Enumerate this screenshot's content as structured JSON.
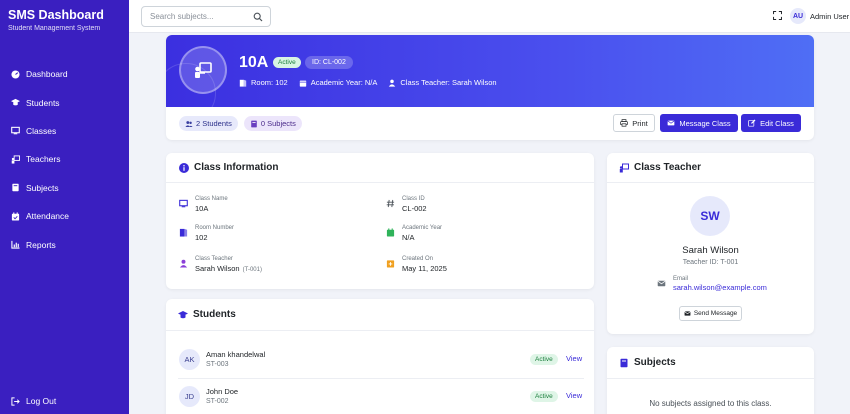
{
  "sidebar": {
    "title": "SMS Dashboard",
    "subtitle": "Student Management System",
    "items": [
      {
        "label": "Dashboard",
        "icon": "dashboard-icon"
      },
      {
        "label": "Students",
        "icon": "graduation-cap-icon"
      },
      {
        "label": "Classes",
        "icon": "chalkboard-icon"
      },
      {
        "label": "Teachers",
        "icon": "chalkboard-teacher-icon"
      },
      {
        "label": "Subjects",
        "icon": "book-icon"
      },
      {
        "label": "Attendance",
        "icon": "calendar-check-icon"
      },
      {
        "label": "Reports",
        "icon": "chart-icon"
      }
    ],
    "logout_label": "Log Out"
  },
  "topbar": {
    "search_placeholder": "Search subjects...",
    "avatar_initials": "AU",
    "user_name": "Admin User"
  },
  "class": {
    "name": "10A",
    "status": "Active",
    "id_badge": "ID: CL-002",
    "room": "Room: 102",
    "academic_year": "Academic Year: N/A",
    "class_teacher": "Class Teacher: Sarah Wilson",
    "students_chip": "2 Students",
    "subjects_chip": "0 Subjects"
  },
  "actions": {
    "print": "Print",
    "message": "Message Class",
    "edit": "Edit Class"
  },
  "info": {
    "title": "Class Information",
    "class_name_label": "Class Name",
    "class_name": "10A",
    "class_id_label": "Class ID",
    "class_id": "CL-002",
    "room_label": "Room Number",
    "room": "102",
    "year_label": "Academic Year",
    "year": "N/A",
    "teacher_label": "Class Teacher",
    "teacher": "Sarah Wilson",
    "teacher_code": "(T-001)",
    "created_label": "Created On",
    "created": "May 11, 2025"
  },
  "students": {
    "title": "Students",
    "rows": [
      {
        "initials": "AK",
        "name": "Aman khandelwal",
        "id": "ST-003",
        "status": "Active",
        "action": "View"
      },
      {
        "initials": "JD",
        "name": "John Doe",
        "id": "ST-002",
        "status": "Active",
        "action": "View"
      }
    ]
  },
  "teacher": {
    "title": "Class Teacher",
    "initials": "SW",
    "name": "Sarah Wilson",
    "teacher_id": "Teacher ID: T-001",
    "email_label": "Email",
    "email": "sarah.wilson@example.com",
    "send_label": "Send Message"
  },
  "subjects": {
    "title": "Subjects",
    "empty": "No subjects assigned to this class."
  },
  "colors": {
    "sidebar": "#3a1fc0",
    "accent": "#3a2bd8",
    "success": "#1b7f3c"
  }
}
